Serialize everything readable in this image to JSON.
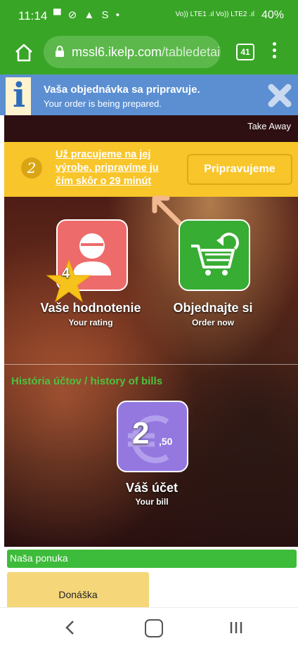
{
  "status_bar": {
    "time": "11:14",
    "left_icons": "▀ ⊘ ▲ S •",
    "network": "Vo)) LTE1 .ıl Vo)) LTE2 .ıl",
    "battery": "40%"
  },
  "browser": {
    "url_main": "mssl6.ikelp.com",
    "url_path": "/tabledetai",
    "tab_count": "41"
  },
  "info_bar": {
    "title": "Vaša objednávka sa pripravuje.",
    "subtitle": "Your order is being prepared."
  },
  "header": {
    "mode": "Take Away"
  },
  "order_status": {
    "step": "2",
    "message": "Už pracujeme na jej výrobe, pripravíme ju čím skôr o 29 minút",
    "button": "Pripravujeme"
  },
  "tiles": {
    "rating": {
      "label": "Vaše hodnotenie",
      "sublabel": "Your rating",
      "stars": "4"
    },
    "order": {
      "label": "Objednajte si",
      "sublabel": "Order now"
    },
    "bill": {
      "label": "Váš účet",
      "sublabel": "Your bill",
      "amount_whole": "2",
      "amount_decimal": ",50"
    }
  },
  "history": {
    "title": "História účtov / history of bills"
  },
  "footer": {
    "section_title": "Naša ponuka",
    "item": "Donáška"
  },
  "colors": {
    "brand_green": "#38a526",
    "info_blue": "#5b8fd2",
    "status_yellow": "#f8c52a",
    "rating_red": "#ee6b6b",
    "order_green": "#38ad34",
    "bill_purple": "#9478e0"
  }
}
